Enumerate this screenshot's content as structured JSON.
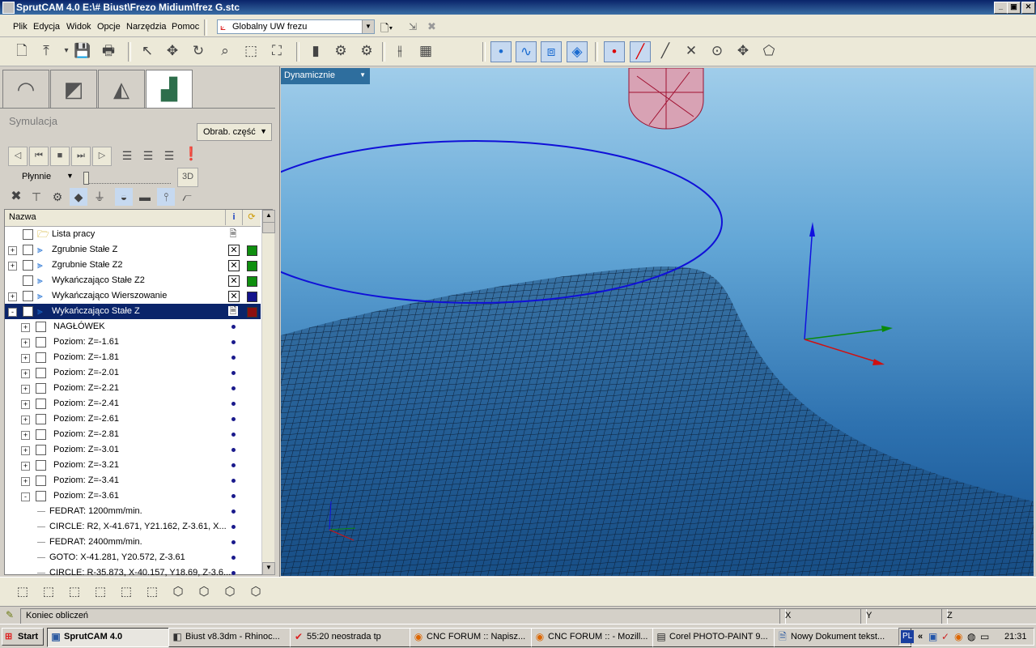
{
  "window": {
    "title": "SprutCAM 4.0 E:\\# Biust\\Frezo Midium\\frez G.stc",
    "min": "_",
    "max": "▣",
    "close": "✕"
  },
  "menu": [
    "Plik",
    "Edycja",
    "Widok",
    "Opcje",
    "Narzędzia",
    "Pomoc"
  ],
  "coordinate_system": {
    "value": "Globalny UW frezu",
    "arrow": "▼"
  },
  "toolbar_icons": [
    "new-file-icon",
    "import-icon",
    "save-icon",
    "print-icon",
    "select-icon",
    "pan-icon",
    "rotate-icon",
    "zoom-icon",
    "zoom-window-icon",
    "zoom-fit-icon",
    "tool-icon",
    "machine-icon",
    "machine2-icon",
    "toolpath-settings-icon",
    "calculator-icon",
    "point-view-icon",
    "curve-view-icon",
    "surface-wire-icon",
    "surface-shade-icon",
    "point-icon",
    "line-icon",
    "knife-icon",
    "cross-icon",
    "circle-center-icon",
    "move-icon",
    "shape-icon"
  ],
  "panel": {
    "title": "Symulacja",
    "part_dropdown": "Obrab. część",
    "speed": "Płynnie",
    "mode_3d": "3D",
    "tree_header": "Nazwa",
    "info_icon": "i",
    "rows": [
      {
        "label": "Lista pracy",
        "level": 0,
        "expand": "",
        "mark": "page",
        "color": ""
      },
      {
        "label": "Zgrubnie Stałe Z",
        "level": 0,
        "expand": "+",
        "mark": "x",
        "color": "#0f8f0f"
      },
      {
        "label": "Zgrubnie Stałe Z2",
        "level": 0,
        "expand": "+",
        "mark": "x",
        "color": "#0f8f0f"
      },
      {
        "label": "Wykańczająco Stałe Z2",
        "level": 0,
        "expand": "",
        "mark": "x",
        "color": "#0f8f0f"
      },
      {
        "label": "Wykańczająco Wierszowanie",
        "level": 0,
        "expand": "+",
        "mark": "x",
        "color": "#14148c"
      },
      {
        "label": "Wykańczająco Stałe Z",
        "level": 0,
        "expand": "-",
        "mark": "page",
        "color": "#8c1010",
        "selected": true
      },
      {
        "label": "NAGŁÓWEK",
        "level": 1,
        "expand": "+",
        "mark": "dot"
      },
      {
        "label": "Poziom: Z=-1.61",
        "level": 1,
        "expand": "+",
        "mark": "dot"
      },
      {
        "label": "Poziom: Z=-1.81",
        "level": 1,
        "expand": "+",
        "mark": "dot"
      },
      {
        "label": "Poziom: Z=-2.01",
        "level": 1,
        "expand": "+",
        "mark": "dot"
      },
      {
        "label": "Poziom: Z=-2.21",
        "level": 1,
        "expand": "+",
        "mark": "dot"
      },
      {
        "label": "Poziom: Z=-2.41",
        "level": 1,
        "expand": "+",
        "mark": "dot"
      },
      {
        "label": "Poziom: Z=-2.61",
        "level": 1,
        "expand": "+",
        "mark": "dot"
      },
      {
        "label": "Poziom: Z=-2.81",
        "level": 1,
        "expand": "+",
        "mark": "dot"
      },
      {
        "label": "Poziom: Z=-3.01",
        "level": 1,
        "expand": "+",
        "mark": "dot"
      },
      {
        "label": "Poziom: Z=-3.21",
        "level": 1,
        "expand": "+",
        "mark": "dot"
      },
      {
        "label": "Poziom: Z=-3.41",
        "level": 1,
        "expand": "+",
        "mark": "dot"
      },
      {
        "label": "Poziom: Z=-3.61",
        "level": 1,
        "expand": "-",
        "mark": "dot"
      },
      {
        "label": "FEDRAT: 1200mm/min.",
        "level": 2,
        "expand": "",
        "mark": "dot"
      },
      {
        "label": "CIRCLE: R2, X-41.671, Y21.162, Z-3.61, X...",
        "level": 2,
        "expand": "",
        "mark": "dot"
      },
      {
        "label": "FEDRAT: 2400mm/min.",
        "level": 2,
        "expand": "",
        "mark": "dot"
      },
      {
        "label": "GOTO: X-41.281, Y20.572, Z-3.61",
        "level": 2,
        "expand": "",
        "mark": "dot"
      },
      {
        "label": "CIRCLE: R-35.873, X-40.157, Y18.69, Z-3.6...",
        "level": 2,
        "expand": "",
        "mark": "dot"
      }
    ]
  },
  "viewport": {
    "view_mode": "Dynamicznie"
  },
  "status": {
    "message": "Koniec obliczeń",
    "x_label": "X",
    "y_label": "Y",
    "z_label": "Z"
  },
  "taskbar": {
    "start": "Start",
    "tasks": [
      {
        "label": "SprutCAM 4.0",
        "active": true
      },
      {
        "label": "Biust v8.3dm - Rhinoc...",
        "active": false
      },
      {
        "label": "55:20 neostrada tp",
        "active": false
      },
      {
        "label": "CNC FORUM :: Napisz...",
        "active": false
      },
      {
        "label": "CNC FORUM :: - Mozill...",
        "active": false
      },
      {
        "label": "Corel PHOTO-PAINT 9...",
        "active": false
      },
      {
        "label": "Nowy Dokument tekst...",
        "active": false
      }
    ],
    "lang": "PL",
    "chevron": "«",
    "clock": "21:31"
  }
}
